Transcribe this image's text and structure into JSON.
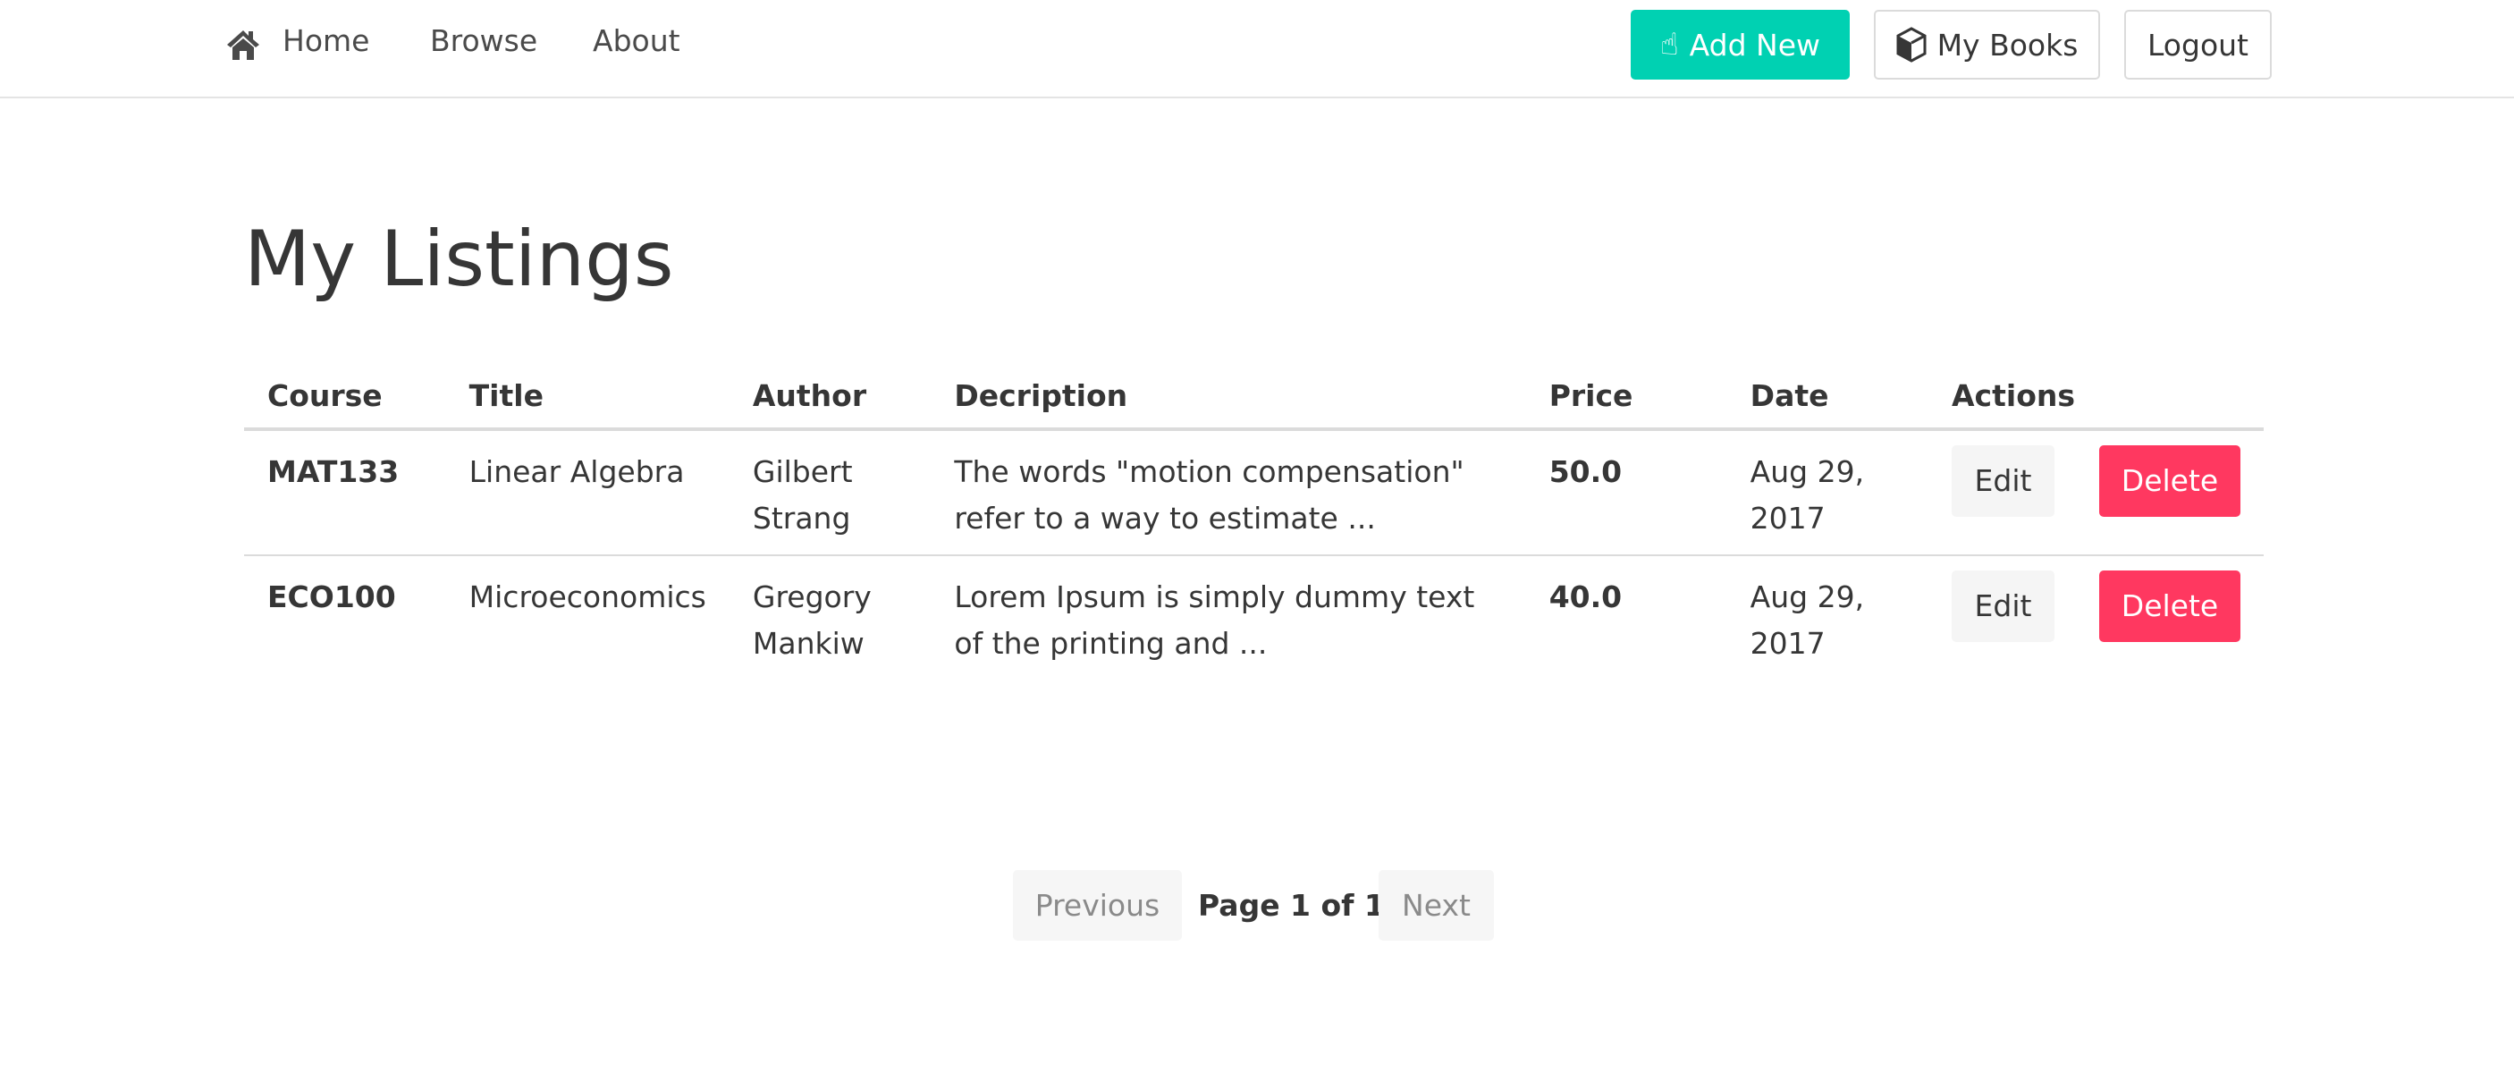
{
  "nav": {
    "home": "Home",
    "browse": "Browse",
    "about": "About",
    "add_new": "Add New",
    "my_books": "My Books",
    "logout": "Logout"
  },
  "page_title": "My Listings",
  "table": {
    "headers": [
      "Course",
      "Title",
      "Author",
      "Decription",
      "Price",
      "Date",
      "Actions"
    ],
    "rows": [
      {
        "course": "MAT133",
        "title": "Linear Algebra",
        "author": "Gilbert Strang",
        "description": "The words \"motion compensation\" refer to a way to estimate ...",
        "price": "50.0",
        "date": "Aug 29, 2017",
        "edit": "Edit",
        "delete": "Delete"
      },
      {
        "course": "ECO100",
        "title": "Microeconomics",
        "author": "Gregory Mankiw",
        "description": "Lorem Ipsum is simply dummy text of the printing and ...",
        "price": "40.0",
        "date": "Aug 29, 2017",
        "edit": "Edit",
        "delete": "Delete"
      }
    ]
  },
  "pagination": {
    "previous": "Previous",
    "status": "Page 1 of 1.",
    "next": "Next"
  },
  "colors": {
    "primary": "#00d1b2",
    "danger": "#ff3860"
  }
}
